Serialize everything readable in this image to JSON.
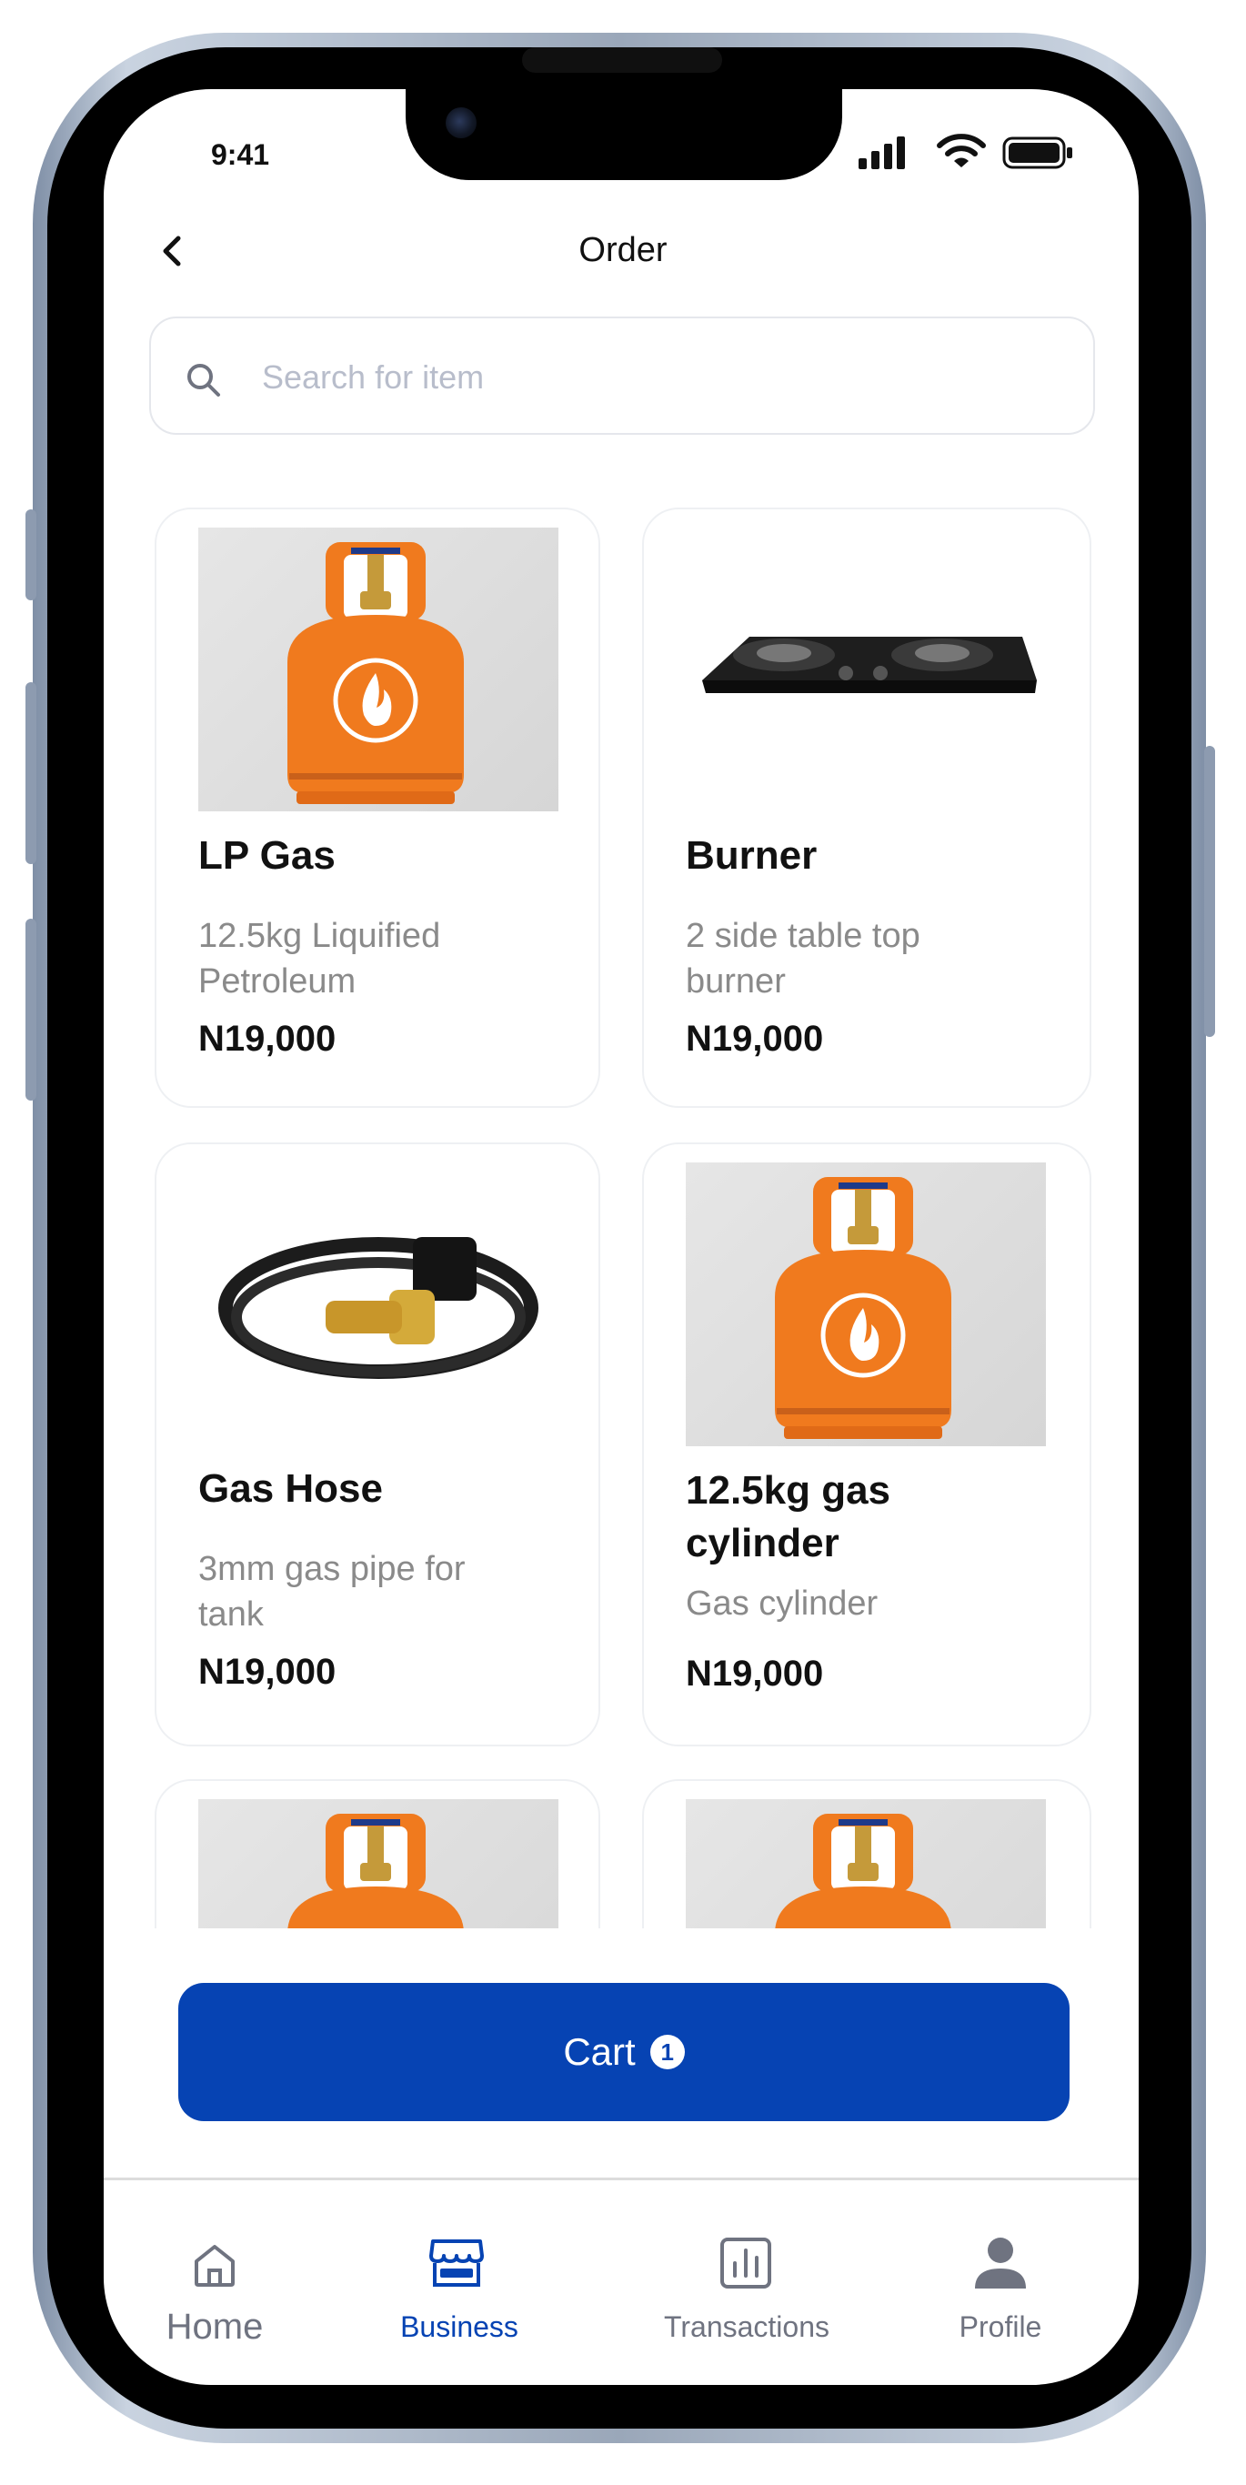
{
  "status_bar": {
    "time": "9:41"
  },
  "header": {
    "title": "Order"
  },
  "search": {
    "placeholder": "Search for item",
    "value": ""
  },
  "products": [
    {
      "name": "LP Gas",
      "description": "12.5kg Liquified Petroleum",
      "price": "N19,000",
      "image": "gas-cylinder"
    },
    {
      "name": "Burner",
      "description": "2 side table top burner",
      "price": "N19,000",
      "image": "gas-burner"
    },
    {
      "name": "Gas Hose",
      "description": "3mm gas pipe for tank",
      "price": "N19,000",
      "image": "gas-hose"
    },
    {
      "name": "12.5kg gas cylinder",
      "description": "Gas cylinder",
      "price": "N19,000",
      "image": "gas-cylinder"
    },
    {
      "name": "",
      "description": "",
      "price": "",
      "image": "gas-cylinder"
    },
    {
      "name": "",
      "description": "",
      "price": "",
      "image": "gas-cylinder"
    }
  ],
  "cart": {
    "label": "Cart",
    "count": "1"
  },
  "nav": {
    "items": [
      {
        "label": "Home",
        "icon": "home-icon",
        "active": false
      },
      {
        "label": "Business",
        "icon": "store-icon",
        "active": true
      },
      {
        "label": "Transactions",
        "icon": "bar-chart-icon",
        "active": false
      },
      {
        "label": "Profile",
        "icon": "person-icon",
        "active": false
      }
    ]
  },
  "colors": {
    "primary": "#0643b3",
    "cylinder": "#f07a1e",
    "inactive": "#6f7380"
  }
}
